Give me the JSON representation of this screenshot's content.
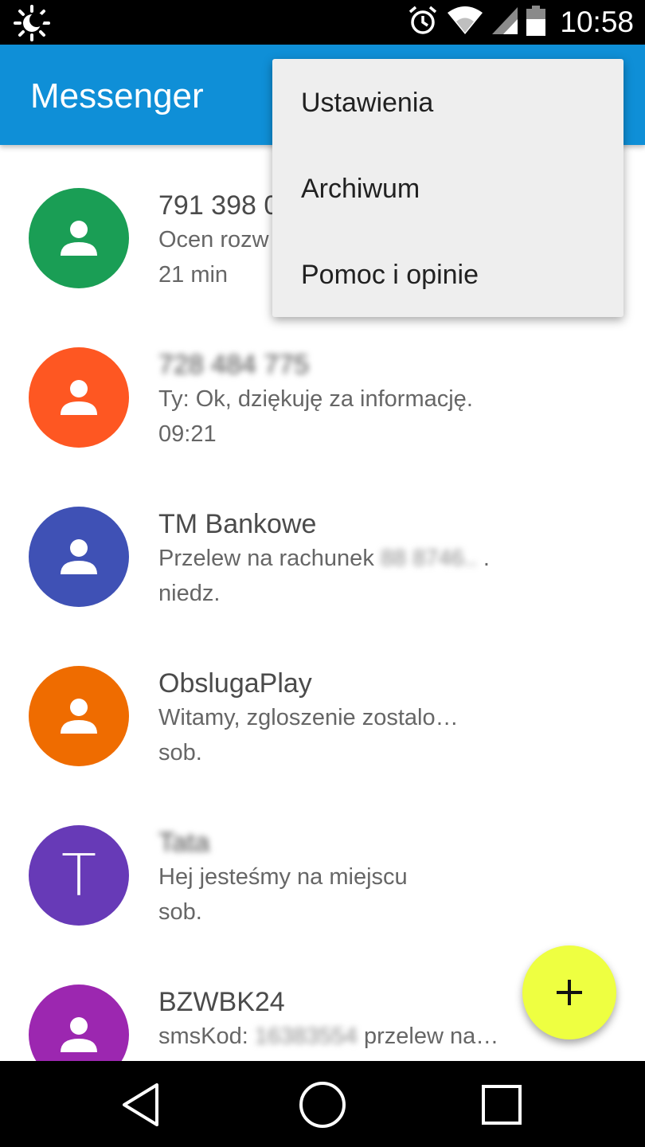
{
  "status_bar": {
    "time": "10:58",
    "icons": [
      "weather-icon",
      "alarm-icon",
      "wifi-icon",
      "signal-icon",
      "battery-icon"
    ]
  },
  "app_bar": {
    "title": "Messenger",
    "color": "#0f8fd7"
  },
  "overflow_menu": {
    "items": [
      "Ustawienia",
      "Archiwum",
      "Pomoc i opinie"
    ]
  },
  "conversations": [
    {
      "name": "791 398 0",
      "message": "Ocen rozw",
      "time": "21 min",
      "avatar_color": "#1a9e55",
      "avatar": "person-icon"
    },
    {
      "name": "728 484 775",
      "name_blurred": true,
      "message": "Ty: Ok, dziękuję za informację.",
      "time": "09:21",
      "avatar_color": "#fe5722",
      "avatar": "person-icon"
    },
    {
      "name": "TM Bankowe",
      "message": "Przelew na rachunek",
      "message_blurred_part": "88 8746..",
      "message_suffix": ".",
      "time": "niedz.",
      "avatar_color": "#3f51b5",
      "avatar": "person-icon"
    },
    {
      "name": "ObslugaPlay",
      "message": "Witamy, zgloszenie zostalo…",
      "time": "sob.",
      "avatar_color": "#ef6c00",
      "avatar": "person-icon"
    },
    {
      "name": "Tata",
      "name_blurred": true,
      "message": "Hej jesteśmy na miejscu",
      "time": "sob.",
      "avatar_color": "#673ab7",
      "avatar_letter": "T"
    },
    {
      "name": "BZWBK24",
      "message_prefix": "smsKod:",
      "message_blurred_part": "16383554",
      "message": "przelew na…",
      "avatar_color": "#9c27b0",
      "avatar": "person-icon"
    }
  ],
  "fab": {
    "icon": "plus-icon",
    "color": "#eeff41"
  },
  "nav_bar": {
    "icons": [
      "back-icon",
      "home-icon",
      "recents-icon"
    ]
  }
}
